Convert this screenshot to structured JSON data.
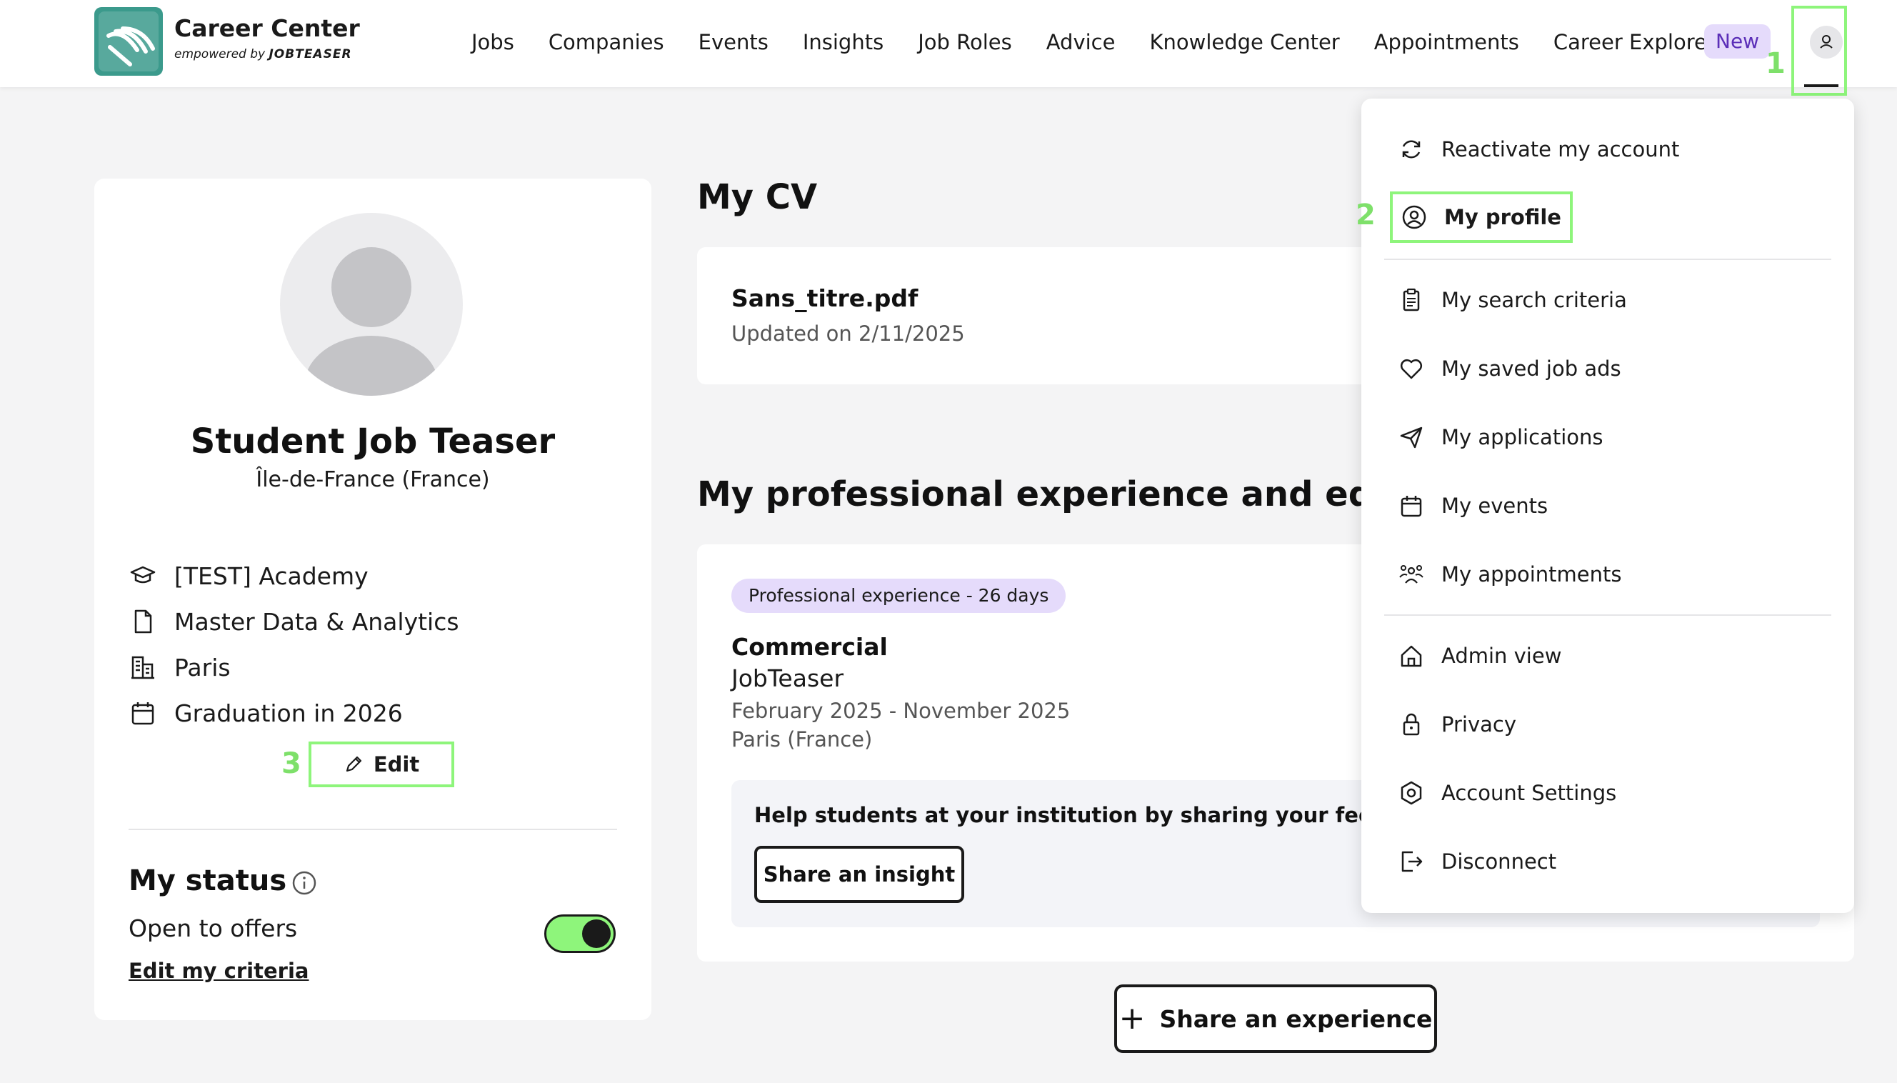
{
  "header": {
    "brand_name": "Career Center",
    "brand_sub_prefix": "empowered by",
    "brand_sub_name": "JOBTEASER",
    "nav": [
      "Jobs",
      "Companies",
      "Events",
      "Insights",
      "Job Roles",
      "Advice",
      "Knowledge Center",
      "Appointments",
      "Career Explorer"
    ],
    "new_badge": "New",
    "user_icon": "user-icon"
  },
  "steps": [
    "1",
    "2",
    "3"
  ],
  "profile": {
    "name": "Student Job Teaser",
    "location": "Île-de-France (France)",
    "school": "[TEST] Academy",
    "program": "Master Data & Analytics",
    "city": "Paris",
    "graduation": "Graduation in 2026",
    "edit_label": "Edit",
    "status_title": "My status",
    "open_label": "Open to offers",
    "open_to_offers": true,
    "edit_criteria": "Edit my criteria"
  },
  "cv": {
    "title": "My CV",
    "file_name": "Sans_titre.pdf",
    "updated": "Updated on 2/11/2025"
  },
  "experience": {
    "title": "My professional experience and educatio",
    "tag": "Professional experience - 26 days",
    "role": "Commercial",
    "company": "JobTeaser",
    "dates": "February 2025 - November 2025",
    "place": "Paris (France)",
    "feedback_text": "Help students at your institution by sharing your feedback.",
    "insight_button": "Share an insight",
    "share_button": "Share an experience"
  },
  "menu": {
    "items": [
      {
        "label": "Reactivate my account",
        "icon": "refresh-icon"
      },
      {
        "label": "My profile",
        "icon": "user-circle-icon"
      },
      {
        "label": "My search criteria",
        "icon": "clipboard-icon"
      },
      {
        "label": "My saved job ads",
        "icon": "heart-icon"
      },
      {
        "label": "My applications",
        "icon": "send-icon"
      },
      {
        "label": "My events",
        "icon": "calendar-icon"
      },
      {
        "label": "My appointments",
        "icon": "people-icon"
      },
      {
        "label": "Admin view",
        "icon": "home-icon"
      },
      {
        "label": "Privacy",
        "icon": "lock-icon"
      },
      {
        "label": "Account Settings",
        "icon": "settings-icon"
      },
      {
        "label": "Disconnect",
        "icon": "logout-icon"
      }
    ]
  },
  "colors": {
    "highlight": "#8ef57b",
    "badge_bg": "#e5dbfb",
    "badge_text": "#5b2fb8",
    "logo": "#3b9a8c"
  }
}
